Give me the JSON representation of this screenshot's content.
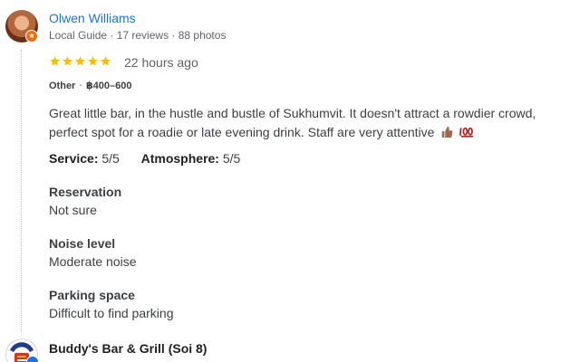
{
  "review": {
    "author": {
      "name": "Olwen Williams",
      "meta": "Local Guide · 17 reviews · 88 photos",
      "badge_icon": "local-guide-star-icon"
    },
    "rating_stars": 5,
    "time": "22 hours ago",
    "tags": {
      "category": "Other",
      "price": "฿400–600"
    },
    "text": "Great little bar, in the hustle and bustle of Sukhumvit. It doesn't attract a rowdier crowd, perfect spot for a roadie or late evening drink. Staff are very attentive",
    "emojis": [
      "thumbs-up-emoji",
      "hundred-points-emoji"
    ],
    "service": {
      "label": "Service:",
      "value": "5/5"
    },
    "atmosphere": {
      "label": "Atmosphere:",
      "value": "5/5"
    },
    "reservation": {
      "label": "Reservation",
      "value": "Not sure"
    },
    "noise": {
      "label": "Noise level",
      "value": "Moderate noise"
    },
    "parking": {
      "label": "Parking space",
      "value": "Difficult to find parking"
    }
  },
  "owner_reply": {
    "name": "Buddy's Bar & Grill (Soi 8)"
  },
  "colors": {
    "link": "#1a73e8",
    "star": "#fbbc04",
    "badge": "#e8710a"
  }
}
